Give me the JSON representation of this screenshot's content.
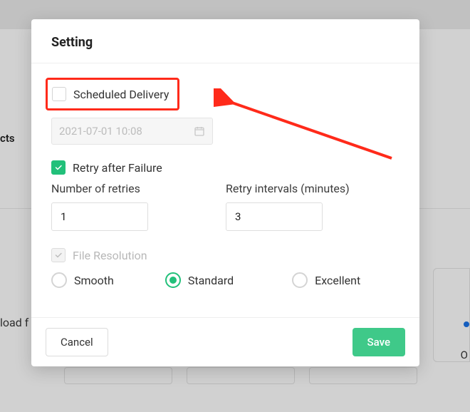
{
  "modal": {
    "title": "Setting",
    "scheduled_delivery": {
      "label": "Scheduled Delivery",
      "checked": false,
      "datetime_value": "2021-07-01 10:08"
    },
    "retry": {
      "label": "Retry after Failure",
      "checked": true,
      "number_label": "Number of retries",
      "number_value": "1",
      "interval_label": "Retry intervals (minutes)",
      "interval_value": "3"
    },
    "file_resolution": {
      "label": "File Resolution",
      "options": {
        "smooth": "Smooth",
        "standard": "Standard",
        "excellent": "Excellent"
      },
      "selected": "standard"
    },
    "buttons": {
      "cancel": "Cancel",
      "save": "Save"
    }
  },
  "background": {
    "side_text_1": "cts",
    "side_text_2": "load f",
    "right_o": "O"
  },
  "colors": {
    "accent": "#22c07a",
    "annotation": "#ff2a1a"
  }
}
